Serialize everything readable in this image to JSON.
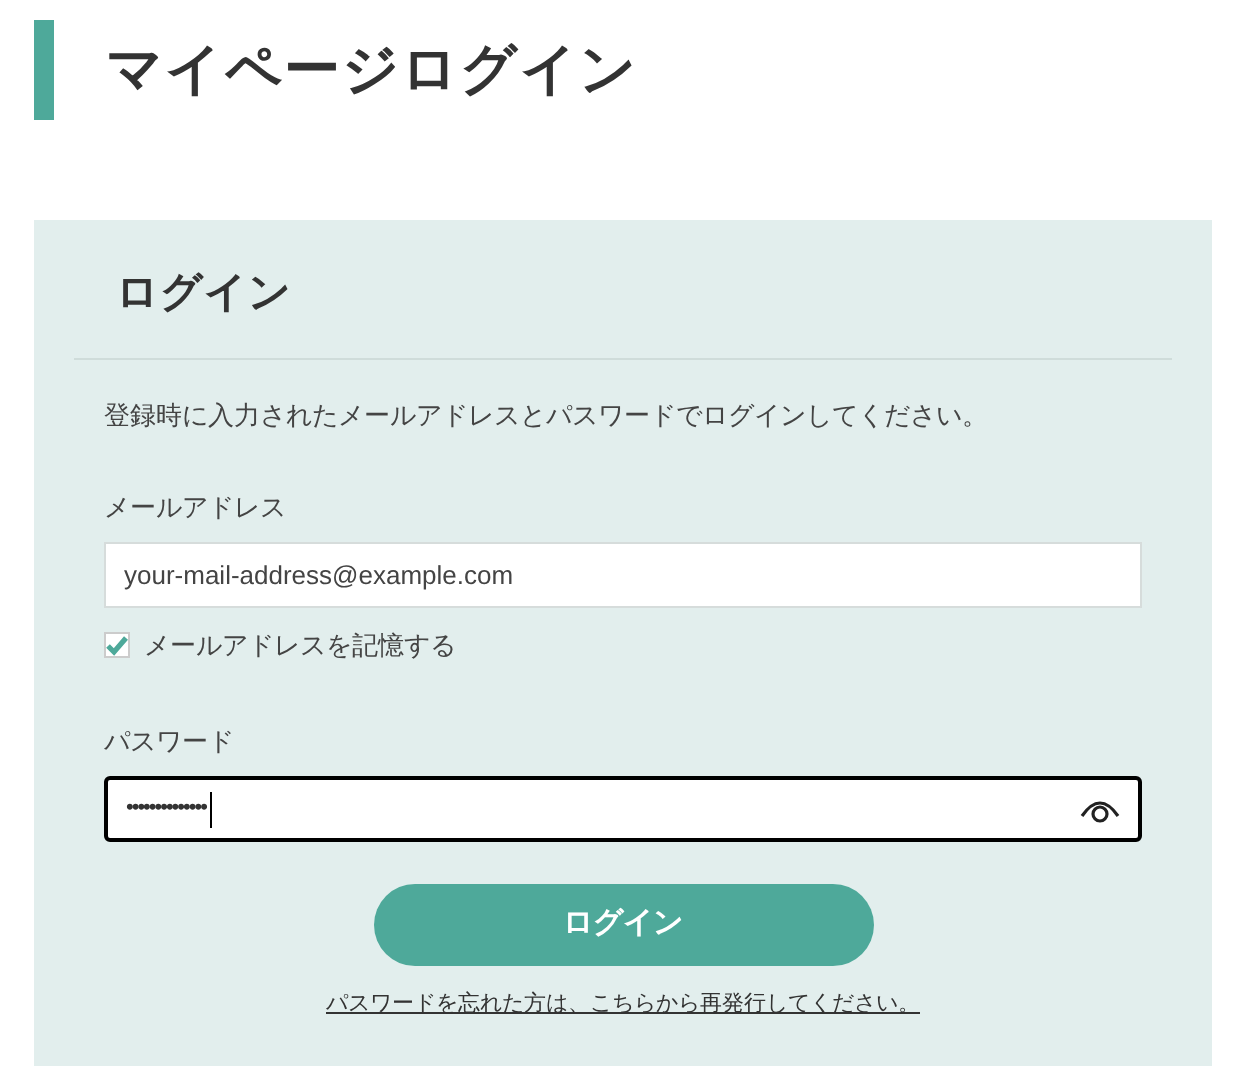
{
  "page_title": "マイページログイン",
  "panel": {
    "title": "ログイン",
    "description": "登録時に入力されたメールアドレスとパスワードでログインしてください。",
    "email": {
      "label": "メールアドレス",
      "placeholder": "your-mail-address@example.com"
    },
    "remember": {
      "label": "メールアドレスを記憶する",
      "checked": true
    },
    "password": {
      "label": "パスワード",
      "value": "••••••••••••••",
      "focused": true
    },
    "submit": "ログイン",
    "forgot_link": "パスワードを忘れた方は、こちらから再発行してください。"
  }
}
